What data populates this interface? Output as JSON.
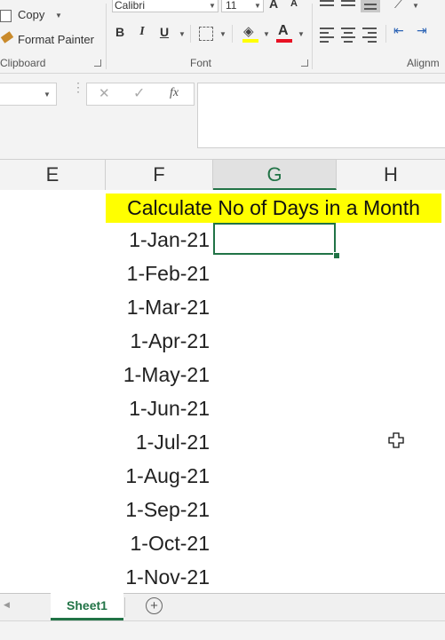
{
  "ribbon": {
    "clipboard": {
      "copy_label": "Copy",
      "format_painter_label": "Format Painter",
      "group_label": "Clipboard"
    },
    "font": {
      "font_name": "Calibri",
      "font_size": "11",
      "bold": "B",
      "italic": "I",
      "underline": "U",
      "group_label": "Font",
      "grow_glyph": "A",
      "shrink_glyph": "A",
      "font_color_glyph": "A",
      "font_color": "#e81123",
      "highlight_color": "#ffff00"
    },
    "alignment": {
      "group_label": "Alignm"
    }
  },
  "formula_bar": {
    "cancel_glyph": "✕",
    "enter_glyph": "✓",
    "fx_glyph": "fx",
    "content": ""
  },
  "columns": [
    "E",
    "F",
    "G",
    "H"
  ],
  "selected_column": "G",
  "sheet": {
    "banner": "Calculate No of Days in a Month",
    "banner_color": "#ffff00",
    "dates": [
      "1-Jan-21",
      "1-Feb-21",
      "1-Mar-21",
      "1-Apr-21",
      "1-May-21",
      "1-Jun-21",
      "1-Jul-21",
      "1-Aug-21",
      "1-Sep-21",
      "1-Oct-21",
      "1-Nov-21"
    ]
  },
  "tabs": {
    "active": "Sheet1",
    "add_glyph": "+"
  },
  "accent_color": "#217346"
}
